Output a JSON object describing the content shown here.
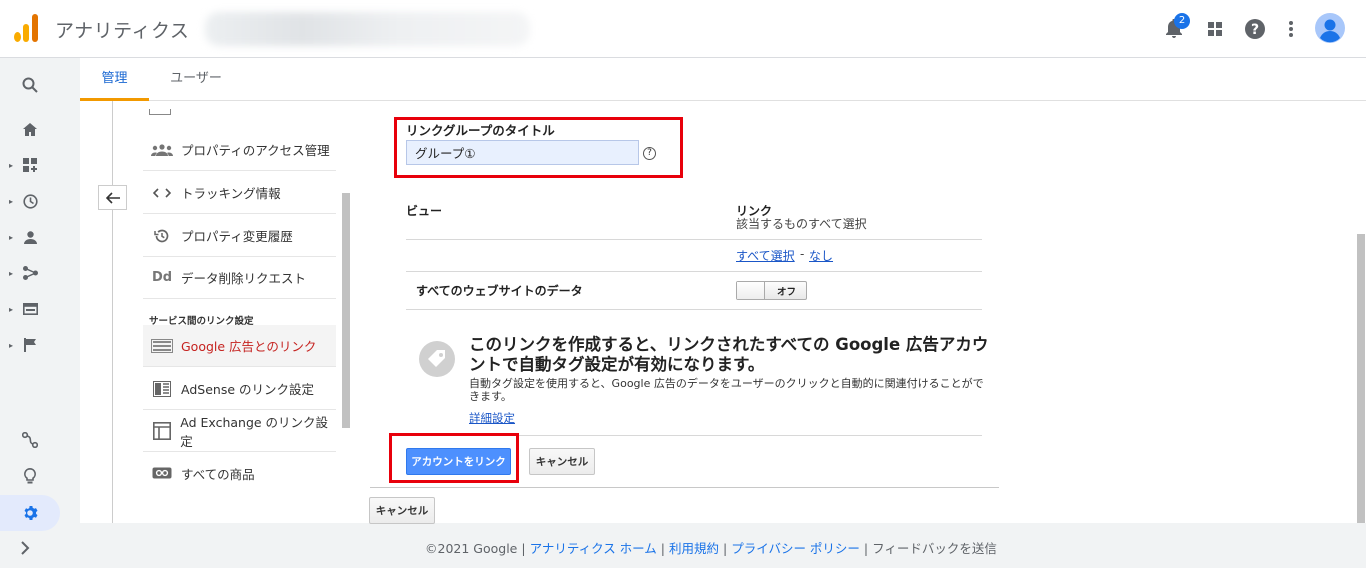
{
  "app": {
    "title": "アナリティクス",
    "notification_count": "2"
  },
  "colors": {
    "accent": "#1a73e8",
    "tab_underline": "#f29900",
    "active_menu": "#c5221f",
    "highlight_box": "#e8000b",
    "primary_button": "#4d90fe"
  },
  "top_icons": [
    "bell-icon",
    "apps-grid-icon",
    "help-icon",
    "more-vert-icon",
    "avatar"
  ],
  "left_nav": [
    "search-icon",
    "home-icon",
    "customization-icon",
    "realtime-icon",
    "audience-icon",
    "acquisition-icon",
    "behavior-icon",
    "conversions-icon",
    "attribution-icon",
    "discover-icon",
    "admin-gear-icon",
    "expand-icon"
  ],
  "tabs": {
    "admin": "管理",
    "user": "ユーザー"
  },
  "side_menu": {
    "items": [
      {
        "label": "プロパティのアクセス管理",
        "icon": "people-icon"
      },
      {
        "label": "トラッキング情報",
        "icon": "code-icon"
      },
      {
        "label": "プロパティ変更履歴",
        "icon": "history-icon"
      },
      {
        "label": "データ削除リクエスト",
        "icon_text": "Dd"
      }
    ],
    "section_title": "サービス間のリンク設定",
    "link_items": [
      {
        "label": "Google 広告とのリンク",
        "icon": "ads-icon"
      },
      {
        "label": "AdSense のリンク設定",
        "icon": "adsense-icon"
      },
      {
        "label": "Ad Exchange のリンク設定",
        "icon": "adexchange-icon"
      },
      {
        "label": "すべての商品",
        "icon": "link-icon"
      }
    ]
  },
  "form": {
    "group_title_label": "リンクグループのタイトル",
    "group_title_value": "グループ①",
    "help": "?",
    "view_header": "ビュー",
    "link_header": "リンク",
    "link_subheader": "該当するものすべて選択",
    "select_all": "すべて選択",
    "separator": "-",
    "select_none": "なし",
    "row_label": "すべてのウェブサイトのデータ",
    "toggle_state": "オフ",
    "info_heading": "このリンクを作成すると、リンクされたすべての Google 広告アカウントで自動タグ設定が有効になります。",
    "info_desc": "自動タグ設定を使用すると、Google 広告のデータをユーザーのクリックと自動的に関連付けることができます。",
    "details_link": "詳細設定",
    "link_button": "アカウントをリンク",
    "cancel_button": "キャンセル",
    "outer_cancel_button": "キャンセル"
  },
  "footer": {
    "copyright": "©2021 Google",
    "sep": "|",
    "home": "アナリティクス ホーム",
    "terms": "利用規約",
    "privacy": "プライバシー ポリシー",
    "feedback": "フィードバックを送信"
  }
}
